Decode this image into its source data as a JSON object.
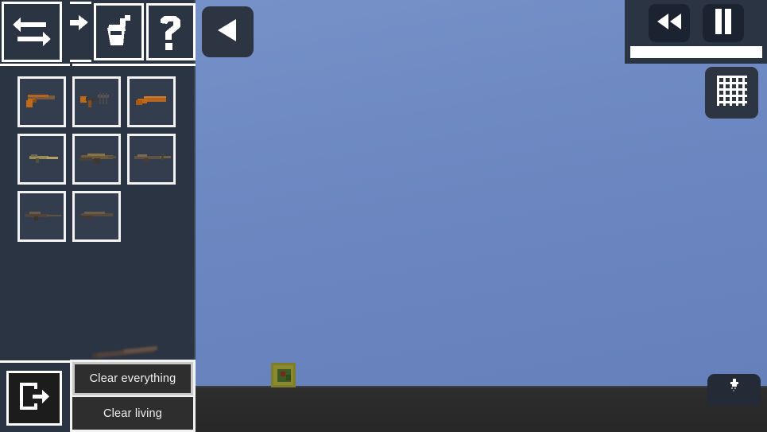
{
  "app": {
    "title": "Sandbox Weapon Spawner"
  },
  "world": {
    "sky_color": "#6b86c0",
    "ground_color": "#2b2b2b",
    "entity_label": "crate-entity"
  },
  "toolbar": {
    "buttons": [
      {
        "name": "swap-button",
        "icon": "swap-arrows-icon",
        "label": "Swap"
      },
      {
        "name": "arrow-button",
        "icon": "arrow-right-icon",
        "label": "Move"
      },
      {
        "name": "paint-button",
        "icon": "paint-bucket-icon",
        "label": "Paint"
      },
      {
        "name": "help-button",
        "icon": "question-mark-icon",
        "label": "?"
      }
    ]
  },
  "inventory": {
    "slots": [
      {
        "name": "slot-pistol",
        "icon": "pistol-icon",
        "label": "Pistol"
      },
      {
        "name": "slot-machine-pistol",
        "icon": "smg-icon",
        "label": "Machine Pistol"
      },
      {
        "name": "slot-sawed-off",
        "icon": "sawed-off-icon",
        "label": "Sawed-off"
      },
      {
        "name": "slot-smg",
        "icon": "smg-short-icon",
        "label": "SMG"
      },
      {
        "name": "slot-assault-rifle",
        "icon": "assault-rifle-icon",
        "label": "Assault Rifle"
      },
      {
        "name": "slot-battle-rifle",
        "icon": "battle-rifle-icon",
        "label": "Battle Rifle"
      },
      {
        "name": "slot-sniper-rifle",
        "icon": "sniper-rifle-icon",
        "label": "Sniper Rifle"
      },
      {
        "name": "slot-shotgun",
        "icon": "shotgun-icon",
        "label": "Shotgun"
      }
    ]
  },
  "bottom_left": {
    "exit_icon": "exit-door-icon",
    "exit_label": "Exit",
    "clear_everything_label": "Clear everything",
    "clear_living_label": "Clear living",
    "dragged_item_label": "shotgun"
  },
  "hud": {
    "back_icon": "play-left-triangle-icon",
    "back_label": "Back",
    "rewind_icon": "rewind-icon",
    "rewind_label": "Rewind",
    "pause_icon": "pause-icon",
    "pause_label": "Pause",
    "progress_value": "100",
    "grid_icon": "grid-icon",
    "grid_label": "Toggle grid",
    "spawn_icon": "spawn-person-icon",
    "spawn_label": "Spawn"
  }
}
